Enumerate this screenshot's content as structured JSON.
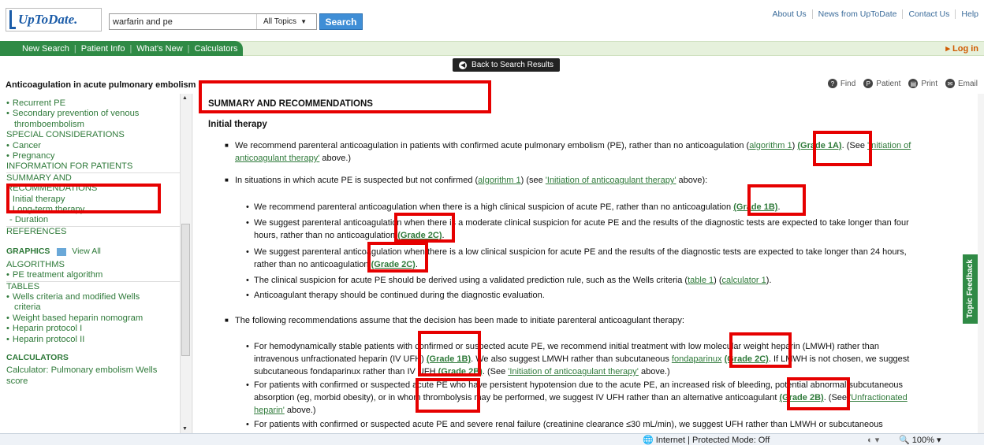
{
  "header": {
    "logo_text": "UpToDate.",
    "search_value": "warfarin and pe",
    "topics_label": "All Topics",
    "search_label": "Search",
    "top_links": [
      "About Us",
      "News from UpToDate",
      "Contact Us",
      "Help"
    ],
    "nav_tabs": [
      "New Search",
      "Patient Info",
      "What's New",
      "Calculators"
    ],
    "login_label": "Log in",
    "back_label": "Back to Search Results"
  },
  "title_row": {
    "page_title": "Anticoagulation in acute pulmonary embolism",
    "tools": [
      "Find",
      "Patient",
      "Print",
      "Email"
    ]
  },
  "sidebar": {
    "recurrent_pe": "Recurrent PE",
    "secondary_prev_1": "Secondary prevention of venous",
    "secondary_prev_2": "thromboembolism",
    "special": "SPECIAL CONSIDERATIONS",
    "cancer": "Cancer",
    "pregnancy": "Pregnancy",
    "info_patients": "INFORMATION FOR PATIENTS",
    "summary_1": "SUMMARY AND",
    "summary_2": "RECOMMENDATIONS",
    "initial": "Initial therapy",
    "longterm": "Long-term therapy",
    "duration": "- Duration",
    "references": "REFERENCES",
    "graphics": "GRAPHICS",
    "view_all": "View All",
    "algorithms": "ALGORITHMS",
    "pe_algo": "PE treatment algorithm",
    "tables": "TABLES",
    "wells_1": "Wells criteria and modified Wells",
    "wells_2": "criteria",
    "weight_heparin": "Weight based heparin nomogram",
    "heparin1": "Heparin protocol I",
    "heparin2": "Heparin protocol II",
    "calculators": "CALCULATORS",
    "calc_1": "Calculator: Pulmonary embolism Wells",
    "calc_2": "score"
  },
  "main": {
    "summary_title": "SUMMARY AND RECOMMENDATIONS",
    "initial_title": "Initial therapy",
    "rec1": {
      "t1": "We recommend parenteral anticoagulation in patients with confirmed acute pulmonary embolism (PE), rather than no anticoagulation (",
      "l1": "algorithm 1",
      "t2": ") ",
      "g": "(Grade 1A)",
      "t3": ". (See ",
      "l2a": "'Initiation of",
      "l2b": "anticoagulant therapy'",
      "t4": " above.)"
    },
    "rec2": {
      "t1": "In situations in which acute PE is suspected but not confirmed (",
      "l1": "algorithm 1",
      "t2": ") (see ",
      "l2": "'Initiation of anticoagulant therapy'",
      "t3": " above):"
    },
    "sub1": {
      "t1": "We recommend parenteral anticoagulation when there is a high clinical suspicion of acute PE, rather than no anticoagulation ",
      "g": "(Grade 1B)",
      "t2": "."
    },
    "sub2": {
      "t1": "We suggest parenteral anticoagulation when there is a moderate clinical suspicion for acute PE and the results of the diagnostic tests are expected to take longer than four",
      "t2": "hours, rather than no anticoagulation ",
      "g": "(Grade 2C)",
      "t3": "."
    },
    "sub3": {
      "t1": "We suggest parenteral anticoagulation when there is a low clinical suspicion for acute PE and the results of the diagnostic tests are expected to take longer than 24 hours,",
      "t2": "rather than no anticoagulation ",
      "g": "(Grade 2C)",
      "t3": "."
    },
    "sub4": {
      "t1": "The clinical suspicion for acute PE should be derived using a validated prediction rule, such as the Wells criteria (",
      "l1": "table 1",
      "t2": ") (",
      "l2": "calculator 1",
      "t3": ")."
    },
    "sub5": {
      "t1": "Anticoagulant therapy should be continued during the diagnostic evaluation."
    },
    "rec3": {
      "t1": "The following recommendations assume that the decision has been made to initiate parenteral anticoagulant therapy:"
    },
    "sub6": {
      "a": "For hemodynamically stable patients with confirmed or suspected acute PE, we recommend initial treatment with low molecular weight heparin (LMWH) rather than",
      "b1": "intravenous unfractionated heparin (IV UFH) ",
      "g1": "(Grade 1B)",
      "b2": ". We also suggest LMWH rather than subcutaneous ",
      "l1": "fondaparinux",
      "b3": " ",
      "g2": "(Grade 2C)",
      "b4": ". If LMWH is not chosen, we suggest",
      "c1": "subcutaneous fondaparinux rather than IV UFH ",
      "g3": "(Grade 2B)",
      "c2": ". (See ",
      "l2": "'Initiation of anticoagulant therapy'",
      "c3": " above.)"
    },
    "sub7": {
      "a": "For patients with confirmed or suspected acute PE who have persistent hypotension due to the acute PE, an increased risk of bleeding, potential abnormal subcutaneous",
      "b1": "absorption (eg, morbid obesity), or in whom thrombolysis may be performed, we suggest IV UFH rather than an alternative anticoagulant ",
      "g": "(Grade 2B)",
      "b2": ". (See ",
      "l1": "'Unfractionated",
      "c1": "heparin'",
      "c2": " above.)"
    },
    "sub8": {
      "a": "For patients with confirmed or suspected acute PE and severe renal failure (creatinine clearance ≤30 mL/min), we suggest UFH rather than LMWH or subcutaneous"
    }
  },
  "feedback_label": "Topic Feedback",
  "status": {
    "zone": "Internet | Protected Mode: Off",
    "zoom": "100%"
  },
  "colors": {
    "link_green": "#2f7a3a",
    "nav_green": "#2f8a45",
    "search_blue": "#3f8ed6",
    "highlight_red": "#e60000"
  }
}
